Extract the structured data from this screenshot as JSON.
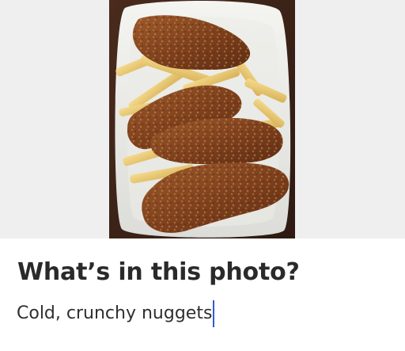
{
  "question": {
    "title": "What’s in this photo?"
  },
  "answer": {
    "value": "Cold, crunchy nuggets"
  },
  "photo": {
    "subject": "fried chicken tenders and fries"
  },
  "colors": {
    "caret": "#2f5bd6",
    "text": "#2f2f2f",
    "heading": "#2a2a2a"
  }
}
